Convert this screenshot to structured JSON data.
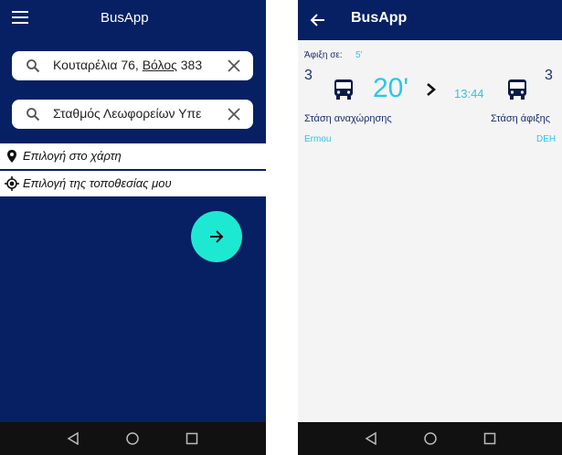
{
  "left": {
    "app_title": "BusApp",
    "from_field": {
      "pre": "Κουταρέλια 76, ",
      "under": "Βόλος",
      "post": " 383"
    },
    "to_field": {
      "value": "Σταθμός Λεωφορείων Υπε"
    },
    "options": [
      {
        "label": "Επιλογή στο χάρτη",
        "icon": "map-pin-icon"
      },
      {
        "label": "Επιλογή της τοποθεσίας μου",
        "icon": "my-location-icon"
      }
    ],
    "fab_icon": "arrow-right-icon"
  },
  "right": {
    "app_title": "BusApp",
    "arrival_label": "Άφιξη σε:",
    "arrival_minutes": "5'",
    "left_bus_line": "3",
    "right_bus_line": "3",
    "wait_time": "20'",
    "arrival_clock": "13:44",
    "departure_stop_label": "Στάση αναχώρησης",
    "arrival_stop_label": "Στάση άφιξης",
    "departure_stop_name": "Ermou",
    "arrival_stop_name": "DEH"
  },
  "colors": {
    "navy": "#072063",
    "accent": "#1de9d3",
    "cyan_text": "#2cc5e8"
  }
}
